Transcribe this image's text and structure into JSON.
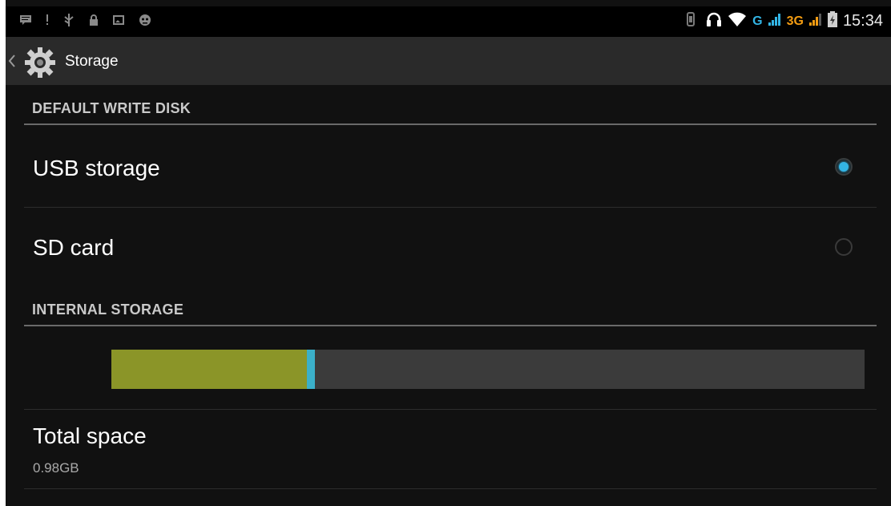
{
  "status_bar": {
    "notification_icons": [
      "message-icon",
      "alert-icon",
      "usb-debug-icon",
      "lock-icon",
      "image-icon",
      "android-icon"
    ],
    "status_icons": [
      "vibrate-icon",
      "headset-icon",
      "wifi-icon",
      "signal-icon",
      "signal-icon",
      "battery-icon"
    ],
    "network_type_1": "G",
    "network_type_2": "3G",
    "time": "15:34",
    "colors": {
      "network_g": "#33b5e5",
      "network_3g": "#f39c12"
    }
  },
  "action_bar": {
    "title": "Storage",
    "icon": "settings-gear-icon"
  },
  "sections": {
    "default_write_disk": {
      "header": "DEFAULT WRITE DISK",
      "options": [
        {
          "label": "USB storage",
          "selected": true
        },
        {
          "label": "SD card",
          "selected": false
        }
      ]
    },
    "internal_storage": {
      "header": "INTERNAL STORAGE",
      "usage_bar": {
        "used_fraction": 0.26,
        "other_fraction": 0.01,
        "colors": {
          "used": "#8b9528",
          "other": "#3bb0c9",
          "free": "#3b3b3b"
        }
      },
      "total_space": {
        "label": "Total space",
        "value": "0.98GB"
      }
    }
  },
  "accent_color": "#33b5e5"
}
